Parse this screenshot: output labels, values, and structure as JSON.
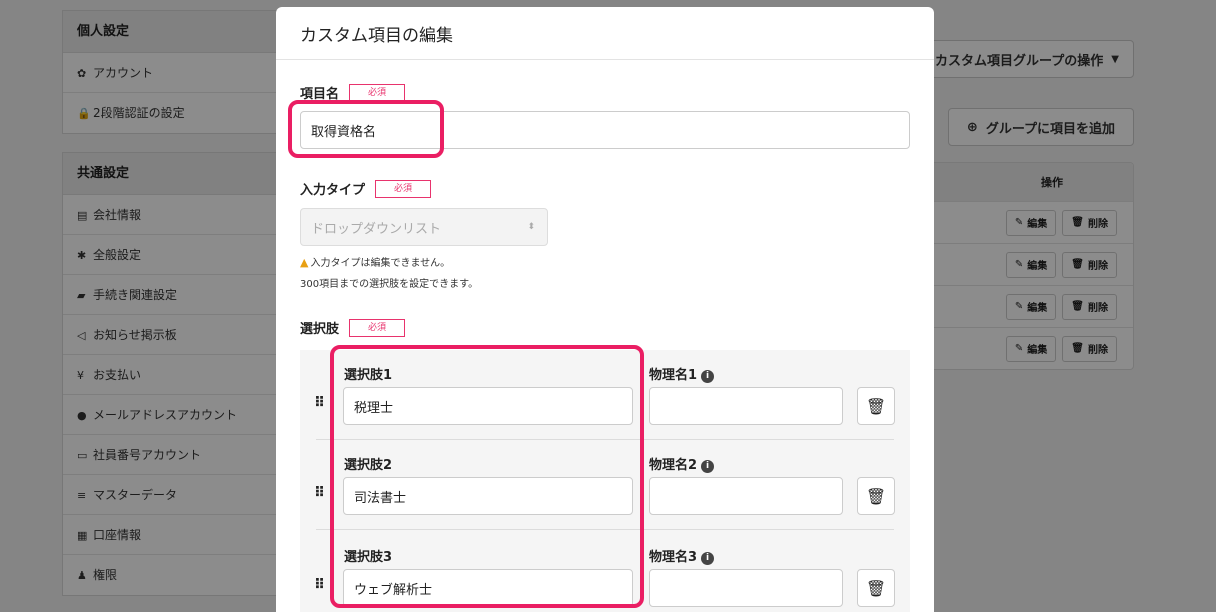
{
  "sidebar": {
    "personal": {
      "title": "個人設定",
      "items": [
        {
          "label": "アカウント",
          "icon": "gear-icon"
        },
        {
          "label": "2段階認証の設定",
          "icon": "lock-icon"
        }
      ]
    },
    "common": {
      "title": "共通設定",
      "items": [
        {
          "label": "会社情報",
          "icon": "building-icon"
        },
        {
          "label": "全般設定",
          "icon": "asterisk-icon"
        },
        {
          "label": "手続き関連設定",
          "icon": "book-icon"
        },
        {
          "label": "お知らせ掲示板",
          "icon": "megaphone-icon"
        },
        {
          "label": "お支払い",
          "icon": "yen-icon"
        },
        {
          "label": "メールアドレスアカウント",
          "icon": "users-icon"
        },
        {
          "label": "社員番号アカウント",
          "icon": "id-card-icon"
        },
        {
          "label": "マスターデータ",
          "icon": "database-icon"
        },
        {
          "label": "口座情報",
          "icon": "bank-card-icon"
        },
        {
          "label": "権限",
          "icon": "user-key-icon"
        }
      ]
    }
  },
  "background": {
    "group_ops_button": "カスタム項目グループの操作",
    "add_item_button": "グループに項目を追加",
    "ops_header": "操作",
    "edit_label": "編集",
    "delete_label": "削除",
    "row_count": 4
  },
  "modal": {
    "title": "カスタム項目の編集",
    "required_badge": "必須",
    "item_name": {
      "label": "項目名",
      "value": "取得資格名"
    },
    "input_type": {
      "label": "入力タイプ",
      "value": "ドロップダウンリスト",
      "warning": "入力タイプは編集できません。",
      "note": "300項目までの選択肢を設定できます。"
    },
    "choices": {
      "label": "選択肢",
      "items": [
        {
          "label": "選択肢1",
          "value": "税理士",
          "physical_label": "物理名1",
          "physical_value": ""
        },
        {
          "label": "選択肢2",
          "value": "司法書士",
          "physical_label": "物理名2",
          "physical_value": ""
        },
        {
          "label": "選択肢3",
          "value": "ウェブ解析士",
          "physical_label": "物理名3",
          "physical_value": ""
        }
      ]
    }
  },
  "colors": {
    "accent": "#ea1e63",
    "required": "#e8336d",
    "warning": "#e8a013"
  }
}
